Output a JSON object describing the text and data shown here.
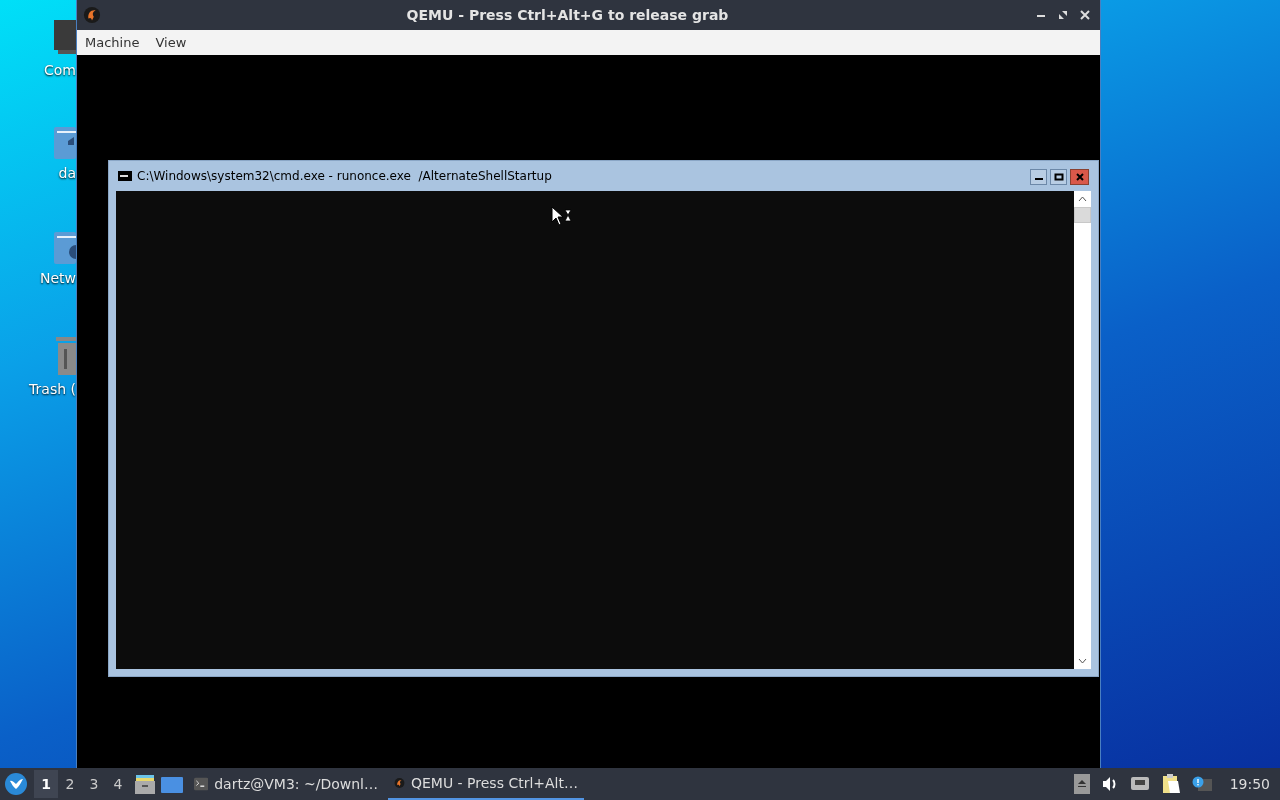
{
  "desktop_icons": [
    {
      "kind": "computer",
      "label": "Com"
    },
    {
      "kind": "home",
      "label": "da"
    },
    {
      "kind": "network",
      "label": "Netw"
    },
    {
      "kind": "trash",
      "label": "Trash ("
    }
  ],
  "qemu_window": {
    "title": "QEMU - Press Ctrl+Alt+G to release grab",
    "menu": [
      "Machine",
      "View"
    ],
    "guest_window": {
      "title": "C:\\Windows\\system32\\cmd.exe - runonce.exe  /AlternateShellStartup"
    }
  },
  "taskbar": {
    "workspaces": [
      {
        "label": "1",
        "selected": true
      },
      {
        "label": "2",
        "selected": false
      },
      {
        "label": "3",
        "selected": false
      },
      {
        "label": "4",
        "selected": false
      }
    ],
    "tasks": [
      {
        "kind": "terminal",
        "label": "dartz@VM3: ~/Downl…",
        "selected": false
      },
      {
        "kind": "qemu",
        "label": "QEMU - Press Ctrl+Alt…",
        "selected": true
      }
    ],
    "clock": "19:50"
  }
}
